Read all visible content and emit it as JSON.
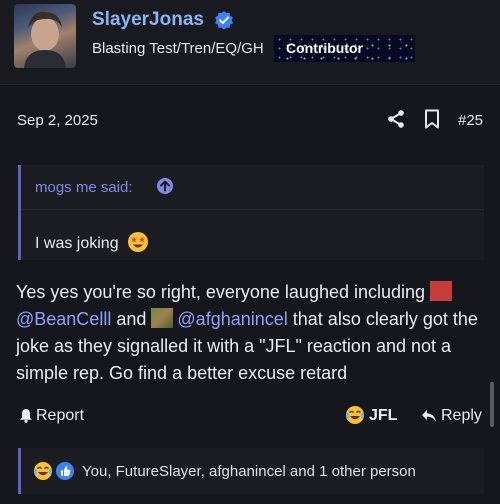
{
  "author": {
    "username": "SlayerJonas",
    "user_title": "Blasting Test/Tren/EQ/GH",
    "banner_label": "Contributor"
  },
  "post": {
    "date": "Sep 2, 2025",
    "number": "#25",
    "quote": {
      "author_line": "mogs me said:",
      "text": "I was joking"
    },
    "message": {
      "part1": "Yes yes you're so right, everyone laughed including",
      "mention1": "@BeanCelll",
      "and_text": "and",
      "mention2": "@afghanincel",
      "part2": "that also clearly got the joke as they signalled it with a \"JFL\" reaction and not a simple rep. Go find a better excuse retard"
    }
  },
  "actions": {
    "report_label": "Report",
    "reaction_label": "JFL",
    "reply_label": "Reply"
  },
  "reactions_summary": "You, FutureSlayer, afghanincel and 1 other person",
  "colors": {
    "background": "#16171c",
    "accent": "#5b63c9",
    "mention": "#8fa0ff",
    "username": "#8ab4f8"
  }
}
